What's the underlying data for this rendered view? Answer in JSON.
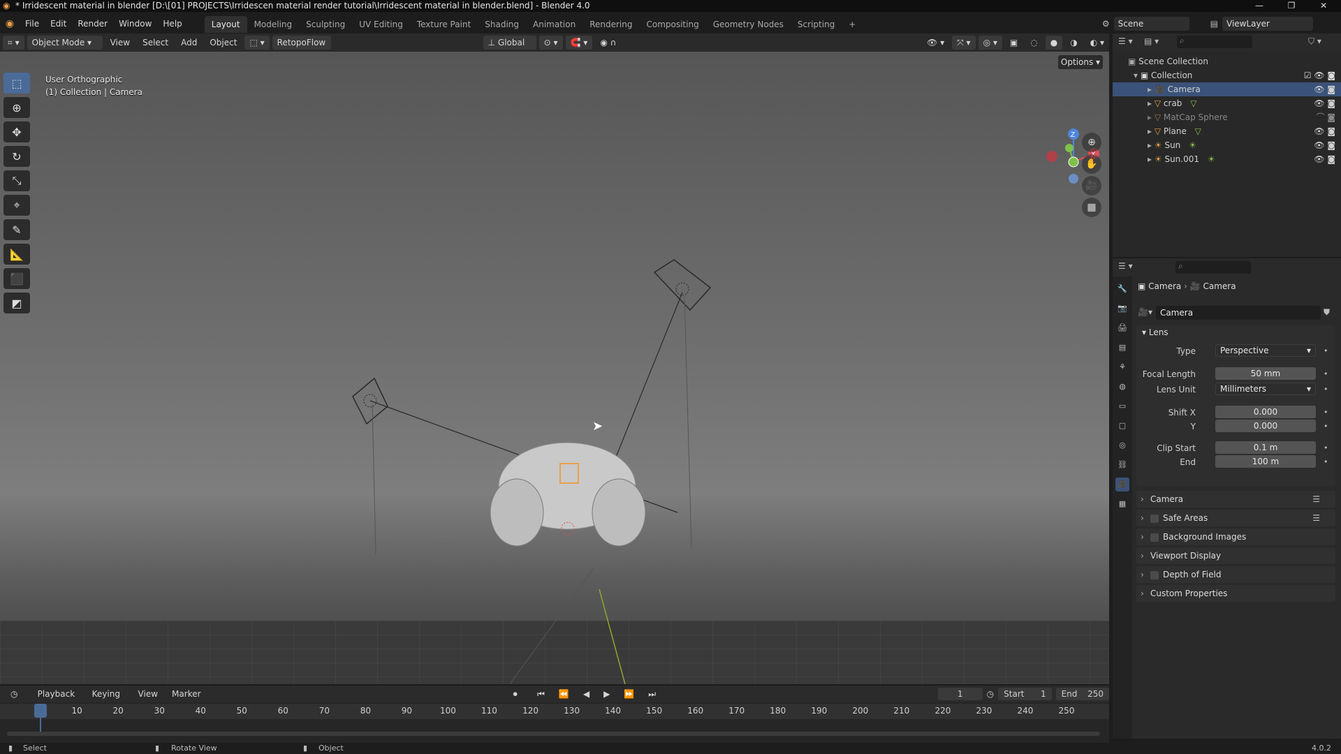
{
  "window": {
    "title": "* Irridescent material in blender [D:\\[01] PROJECTS\\Irridescen material render tutorial\\Irridescent material in blender.blend] - Blender 4.0"
  },
  "menu": {
    "items": [
      "File",
      "Edit",
      "Render",
      "Window",
      "Help"
    ]
  },
  "workspaces": [
    "Layout",
    "Modeling",
    "Sculpting",
    "UV Editing",
    "Texture Paint",
    "Shading",
    "Animation",
    "Rendering",
    "Compositing",
    "Geometry Nodes",
    "Scripting"
  ],
  "scene": {
    "name": "Scene",
    "view_layer": "ViewLayer"
  },
  "header": {
    "mode": "Object Mode",
    "view": "View",
    "select": "Select",
    "add": "Add",
    "object": "Object",
    "retopo": "RetopoFlow",
    "orientation": "Global",
    "options": "Options"
  },
  "viewport": {
    "view_name": "User Orthographic",
    "context": "(1) Collection | Camera"
  },
  "outliner": {
    "root": "Scene Collection",
    "collection": "Collection",
    "items": [
      {
        "name": "Camera",
        "selected": true
      },
      {
        "name": "crab",
        "selected": false
      },
      {
        "name": "MatCap Sphere",
        "selected": false
      },
      {
        "name": "Plane",
        "selected": false
      },
      {
        "name": "Sun",
        "selected": false
      },
      {
        "name": "Sun.001",
        "selected": false
      }
    ]
  },
  "properties": {
    "breadcrumb": [
      "Camera",
      "Camera"
    ],
    "data_name": "Camera",
    "lens_panel": "Lens",
    "type_label": "Type",
    "type_value": "Perspective",
    "focal_label": "Focal Length",
    "focal_value": "50 mm",
    "lensunit_label": "Lens Unit",
    "lensunit_value": "Millimeters",
    "shiftx_label": "Shift X",
    "shiftx_value": "0.000",
    "shifty_label": "Y",
    "shifty_value": "0.000",
    "clipstart_label": "Clip Start",
    "clipstart_value": "0.1 m",
    "clipend_label": "End",
    "clipend_value": "100 m",
    "subpanels": [
      "Camera",
      "Safe Areas",
      "Background Images",
      "Viewport Display",
      "Depth of Field",
      "Custom Properties"
    ]
  },
  "timeline": {
    "playback": "Playback",
    "keying": "Keying",
    "view": "View",
    "marker": "Marker",
    "current_frame": "1",
    "start_label": "Start",
    "start": "1",
    "end_label": "End",
    "end": "250",
    "ticks": [
      "1",
      "10",
      "20",
      "30",
      "40",
      "50",
      "60",
      "70",
      "80",
      "90",
      "100",
      "110",
      "120",
      "130",
      "140",
      "150",
      "160",
      "170",
      "180",
      "190",
      "200",
      "210",
      "220",
      "230",
      "240",
      "250"
    ]
  },
  "statusbar": {
    "select": "Select",
    "rotate": "Rotate View",
    "object": "Object",
    "version": "4.0.2"
  },
  "colors": {
    "accent": "#4a6b98",
    "selected_row": "#3b5279",
    "object_orange": "#e8a04a",
    "vert_green": "#8bc34a",
    "axis_red": "#e0505a",
    "axis_green": "#7fc14b",
    "axis_blue": "#4f86d9"
  }
}
